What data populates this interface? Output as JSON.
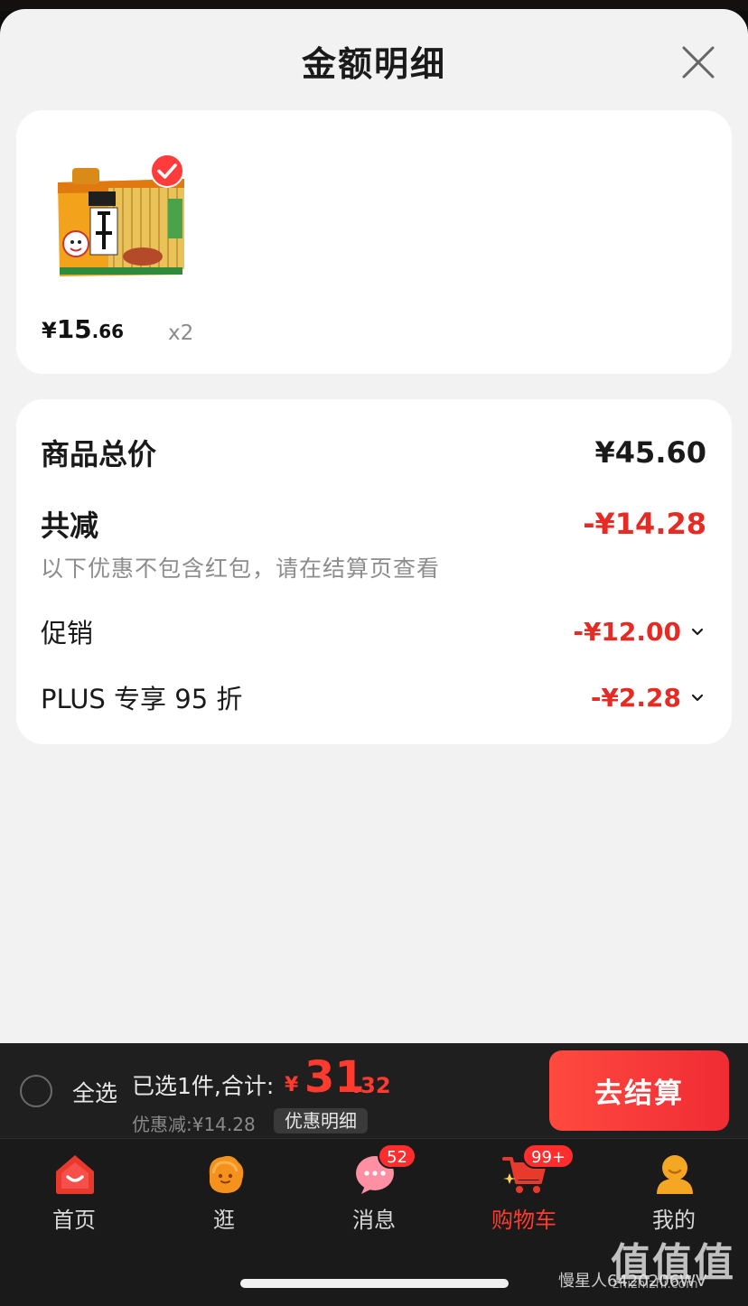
{
  "sheet": {
    "title": "金额明细"
  },
  "product": {
    "image_name": "旺旺仙贝",
    "price_symbol": "¥",
    "price_int": "15",
    "price_dec": ".66",
    "quantity": "x2",
    "selected": true
  },
  "summary": {
    "total_label": "商品总价",
    "total_value": "¥45.60",
    "reduce_label": "共减",
    "reduce_value": "-¥14.28",
    "note": "以下优惠不包含红包，请在结算页查看",
    "items": [
      {
        "label": "促销",
        "value": "-¥12.00"
      },
      {
        "label": "PLUS 专享 95 折",
        "value": "-¥2.28"
      }
    ]
  },
  "checkout": {
    "select_all": "全选",
    "selected_text": "已选1件,合计:",
    "total_symbol": "¥",
    "total_int": "31",
    "total_dec": ".32",
    "discount_text": "优惠减:¥14.28",
    "discount_detail": "优惠明细",
    "button": "去结算"
  },
  "tabs": [
    {
      "label": "首页",
      "icon": "home-icon",
      "active": false
    },
    {
      "label": "逛",
      "icon": "stroll-icon",
      "active": false
    },
    {
      "label": "消息",
      "icon": "message-icon",
      "active": false,
      "badge": "52"
    },
    {
      "label": "购物车",
      "icon": "cart-icon",
      "active": true,
      "badge": "99+"
    },
    {
      "label": "我的",
      "icon": "profile-icon",
      "active": false
    }
  ],
  "watermark": {
    "logo": "值值值",
    "site": "zhizhizhi.com",
    "user": "慢星人6420206WV"
  },
  "colors": {
    "accent": "#e52b24",
    "checkout_button": "#f0363a",
    "sheet_bg": "#f2f2f2"
  }
}
